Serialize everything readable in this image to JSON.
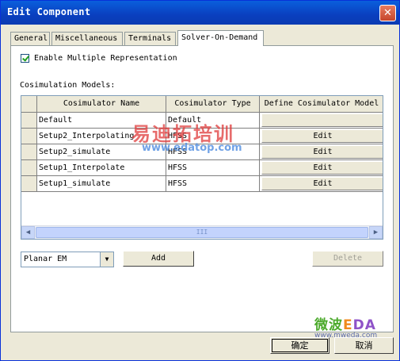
{
  "window": {
    "title": "Edit Component",
    "close_label": "✕"
  },
  "tabs": [
    {
      "label": "General"
    },
    {
      "label": "Miscellaneous"
    },
    {
      "label": "Terminals"
    },
    {
      "label": "Solver-On-Demand"
    }
  ],
  "enable_multiple_representation": {
    "label": "Enable Multiple Representation",
    "checked": true
  },
  "cosim": {
    "section_label": "Cosimulation Models:",
    "columns": [
      "Cosimulator Name",
      "Cosimulator Type",
      "Define Cosimulator Model"
    ],
    "rows": [
      {
        "name": "Default",
        "type": "Default",
        "action": ""
      },
      {
        "name": "Setup2_Interpolating",
        "type": "HFSS",
        "action": "Edit"
      },
      {
        "name": "Setup2_simulate",
        "type": "HFSS",
        "action": "Edit"
      },
      {
        "name": "Setup1_Interpolate",
        "type": "HFSS",
        "action": "Edit"
      },
      {
        "name": "Setup1_simulate",
        "type": "HFSS",
        "action": "Edit"
      }
    ],
    "scroll_thumb_grip": "III"
  },
  "model_type": {
    "selected": "Planar EM"
  },
  "buttons": {
    "add": "Add",
    "delete": "Delete",
    "ok": "确定",
    "cancel": "取消"
  },
  "watermarks": {
    "edatop_cn": "易迪拓培训",
    "edatop_url": "www.edatop.com",
    "mweda_a": "微波",
    "mweda_b": "E",
    "mweda_c": "DA",
    "mweda_url": "www.mweda.com"
  },
  "colors": {
    "title_bar": "#0a50d0",
    "dialog_bg": "#ece9d8",
    "watermark_red": "#e03b3b",
    "watermark_blue": "#4d8be0"
  }
}
